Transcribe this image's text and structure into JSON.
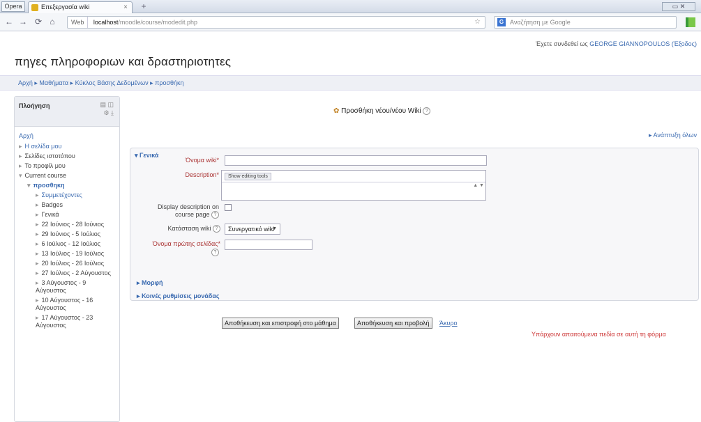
{
  "browser": {
    "menu_label": "Opera",
    "tab_title": "Επεξεργασία wiki",
    "tab_close": "×",
    "new_tab": "+",
    "window_controls": "▭ ✕",
    "nav_back": "←",
    "nav_forward": "→",
    "nav_reload": "⟳",
    "nav_home": "⌂",
    "security_label": "Web",
    "url_host": "localhost",
    "url_path": "/moodle/course/modedit.php",
    "search_placeholder": "Αναζήτηση με Google",
    "search_engine": "G"
  },
  "page": {
    "login_prefix": "Έχετε συνδεθεί ως ",
    "login_user": "GEORGE GIANNOPOULOS (Έξοδος)",
    "site_title": "πηγες πληροφοριων και δραστηριοτητες",
    "breadcrumb": "Αρχή ▸ Μαθήματα ▸ Κύκλος Βάσης Δεδομένων ▸ προσθήκη"
  },
  "sidebar": {
    "title": "Πλοήγηση",
    "icon_top": "▤ ◫",
    "icon_bottom": "⚙ ⤓",
    "items": [
      {
        "label": "Αρχή",
        "level": "l1",
        "cls": "home",
        "arrow": ""
      },
      {
        "label": "Η σελίδα μου",
        "level": "l1",
        "cls": "",
        "arrow": "▸"
      },
      {
        "label": "Σελίδες ιστοτόπου",
        "level": "l1",
        "cls": "plain",
        "arrow": "▸"
      },
      {
        "label": "Το προφίλ μου",
        "level": "l1",
        "cls": "plain",
        "arrow": "▸"
      },
      {
        "label": "Current course",
        "level": "l1",
        "cls": "plain",
        "arrow": "▾"
      },
      {
        "label": "προσθηκη",
        "level": "l2",
        "cls": "bold",
        "arrow": "▾"
      },
      {
        "label": "Συμμετέχοντες",
        "level": "l3",
        "cls": "",
        "arrow": "▸"
      },
      {
        "label": "Badges",
        "level": "l3",
        "cls": "plain",
        "arrow": "▸"
      },
      {
        "label": "Γενικά",
        "level": "l3",
        "cls": "plain",
        "arrow": "▸"
      },
      {
        "label": "22 Ιούνιος - 28 Ιούνιος",
        "level": "l3",
        "cls": "plain",
        "arrow": "▸"
      },
      {
        "label": "29 Ιούνιος - 5 Ιούλιος",
        "level": "l3",
        "cls": "plain",
        "arrow": "▸"
      },
      {
        "label": "6 Ιούλιος - 12 Ιούλιος",
        "level": "l3",
        "cls": "plain",
        "arrow": "▸"
      },
      {
        "label": "13 Ιούλιος - 19 Ιούλιος",
        "level": "l3",
        "cls": "plain",
        "arrow": "▸"
      },
      {
        "label": "20 Ιούλιος - 26 Ιούλιος",
        "level": "l3",
        "cls": "plain",
        "arrow": "▸"
      },
      {
        "label": "27 Ιούλιος - 2 Αύγουστος",
        "level": "l3",
        "cls": "plain",
        "arrow": "▸"
      },
      {
        "label": "3 Αύγουστος - 9 Αύγουστος",
        "level": "l3",
        "cls": "plain",
        "arrow": "▸"
      },
      {
        "label": "10 Αύγουστος - 16 Αύγουστος",
        "level": "l3",
        "cls": "plain",
        "arrow": "▸"
      },
      {
        "label": "17 Αύγουστος - 23 Αύγουστος",
        "level": "l3",
        "cls": "plain",
        "arrow": "▸"
      }
    ]
  },
  "main": {
    "heading": "Προσθήκη νέου/νέου Wiki",
    "heading_icon": "✿",
    "help_glyph": "?",
    "expand_all": "▸ Ανάπτυξη όλων",
    "general_legend": "▾ Γενικά",
    "fields": {
      "wiki_name_label": "Όνομα wiki",
      "description_label": "Description",
      "editor_toggle": "Show editing tools",
      "display_desc_label_1": "Display description on",
      "display_desc_label_2": "course page",
      "wiki_mode_label": "Κατάσταση wiki",
      "wiki_mode_value": "Συνεργατικό wiki",
      "first_page_label": "Όνομα πρώτης σελίδας",
      "required_mark": "*",
      "textarea_scroll": "▲ ▼"
    },
    "sections": [
      {
        "label": "▸ Μορφή"
      },
      {
        "label": "▸ Κοινές ρυθμίσεις μονάδας"
      }
    ],
    "buttons": {
      "save_return": "Αποθήκευση και επιστροφή στο μάθημα",
      "save_display": "Αποθήκευση και προβολή",
      "cancel": "Άκυρο"
    },
    "required_note": "Υπάρχουν απαιτούμενα πεδία σε αυτή τη φόρμα"
  }
}
